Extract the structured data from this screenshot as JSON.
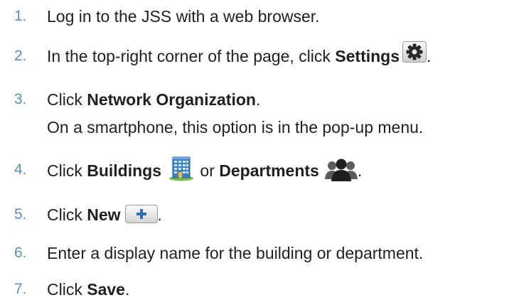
{
  "steps": [
    {
      "number": "1.",
      "parts": [
        "Log in to the JSS with a web browser."
      ]
    },
    {
      "number": "2.",
      "text_before": "In the top-right corner of the page, click ",
      "bold": "Settings",
      "after": "."
    },
    {
      "number": "3.",
      "text_before": "Click ",
      "bold": "Network Organization",
      "after": ".",
      "subtext": "On a smartphone, this option is in the pop-up menu."
    },
    {
      "number": "4.",
      "text_before": "Click ",
      "bold": "Buildings",
      "middle": " or ",
      "bold2": "Departments",
      "after": "."
    },
    {
      "number": "5.",
      "text_before": "Click ",
      "bold": "New",
      "after": "."
    },
    {
      "number": "6.",
      "text": "Enter a display name for the building or department."
    },
    {
      "number": "7.",
      "text_before": "Click ",
      "bold": "Save",
      "after": "."
    }
  ],
  "icons": {
    "settings": "gear-icon",
    "buildings": "building-icon",
    "departments": "people-icon",
    "new": "plus-icon"
  },
  "colors": {
    "step_number": "#5a8fbf",
    "text": "#231f20"
  }
}
